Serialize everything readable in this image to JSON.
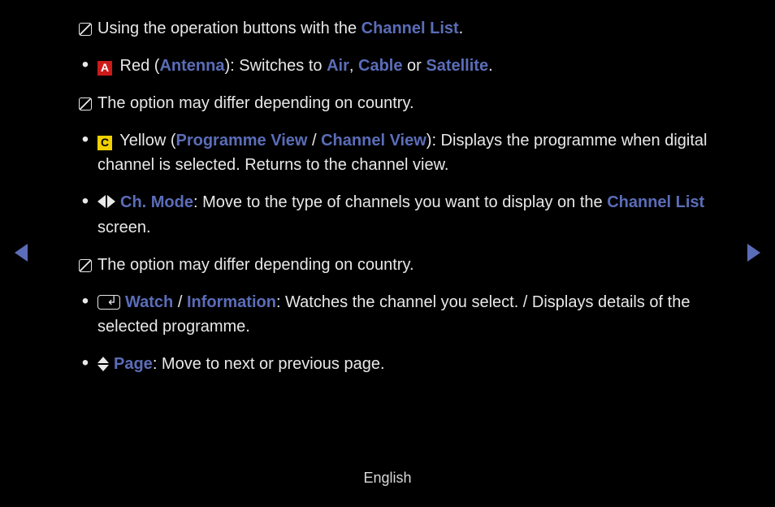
{
  "items": [
    {
      "marker": "note",
      "segments": [
        {
          "t": "Using the operation buttons with the "
        },
        {
          "t": "Channel List",
          "hl": true
        },
        {
          "t": "."
        }
      ]
    },
    {
      "marker": "bullet",
      "segments": [
        {
          "icon": "badge-red",
          "t": "A"
        },
        {
          "t": " Red ("
        },
        {
          "t": "Antenna",
          "hl": true
        },
        {
          "t": "): Switches to "
        },
        {
          "t": "Air",
          "hl": true
        },
        {
          "t": ", "
        },
        {
          "t": "Cable",
          "hl": true
        },
        {
          "t": " or "
        },
        {
          "t": "Satellite",
          "hl": true
        },
        {
          "t": "."
        }
      ]
    },
    {
      "marker": "note",
      "segments": [
        {
          "t": "The option may differ depending on country."
        }
      ]
    },
    {
      "marker": "bullet",
      "segments": [
        {
          "icon": "badge-yellow",
          "t": "C"
        },
        {
          "t": " Yellow ("
        },
        {
          "t": "Programme View",
          "hl": true
        },
        {
          "t": " / "
        },
        {
          "t": "Channel View",
          "hl": true
        },
        {
          "t": "): Displays the programme when digital channel is selected. Returns to the channel view."
        }
      ]
    },
    {
      "marker": "bullet",
      "segments": [
        {
          "icon": "arrow-lr"
        },
        {
          "t": "Ch. Mode",
          "hl": true
        },
        {
          "t": ": Move to the type of channels you want to display on the "
        },
        {
          "t": "Channel List",
          "hl": true
        },
        {
          "t": " screen."
        }
      ]
    },
    {
      "marker": "note",
      "segments": [
        {
          "t": "The option may differ depending on country."
        }
      ]
    },
    {
      "marker": "bullet",
      "segments": [
        {
          "icon": "enter"
        },
        {
          "t": "Watch",
          "hl": true
        },
        {
          "t": " / "
        },
        {
          "t": "Information",
          "hl": true
        },
        {
          "t": ": Watches the channel you select. / Displays details of the selected programme."
        }
      ]
    },
    {
      "marker": "bullet",
      "segments": [
        {
          "icon": "updown"
        },
        {
          "t": "Page",
          "hl": true
        },
        {
          "t": ": Move to next or previous page."
        }
      ]
    }
  ],
  "footer": "English"
}
